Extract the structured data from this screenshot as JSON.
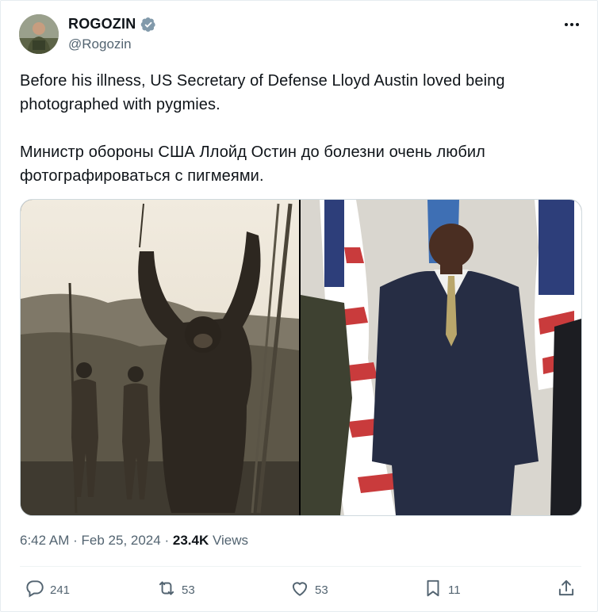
{
  "author": {
    "display_name": "ROGOZIN",
    "handle": "@Rogozin",
    "verified": true,
    "avatar_icon": "avatar-photo"
  },
  "tweet": {
    "text_en": "Before his illness, US Secretary of Defense Lloyd Austin loved being photographed with pygmies.",
    "text_ru": "Министр обороны США Ллойд Остин до болезни очень любил фотографироваться с пигмеями."
  },
  "media": {
    "left_image": "historical-photo-with-ape",
    "right_image": "austin-with-flags"
  },
  "meta": {
    "time": "6:42 AM",
    "separator": "·",
    "date": "Feb 25, 2024",
    "views_count": "23.4K",
    "views_label": "Views"
  },
  "actions": {
    "reply_count": "241",
    "retweet_count": "53",
    "like_count": "53",
    "bookmark_count": "11"
  },
  "colors": {
    "text": "#0f1419",
    "secondary": "#536471",
    "verified": "#829aab",
    "border": "#cfd9de"
  }
}
